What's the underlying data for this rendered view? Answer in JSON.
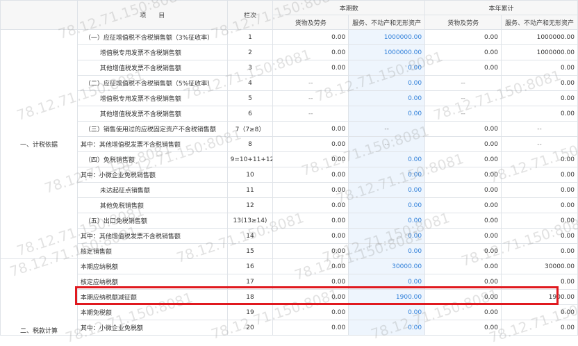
{
  "headers": {
    "item": "项　　目",
    "col": "栏次",
    "current": "本期数",
    "ytd": "本年累计",
    "goods": "货物及劳务",
    "services": "服务、不动产和无形资产"
  },
  "categories": {
    "basis": "一、计税依据",
    "calc": "二、税款计算"
  },
  "rows": [
    {
      "item": "（一）应征增值税不含税销售额（3%征收率）",
      "col": "1",
      "c1": "0.00",
      "c2": "1000000.00",
      "y1": "0.00",
      "y2": "1000000.00",
      "ind": 1
    },
    {
      "item": "增值税专用发票不含税销售额",
      "col": "2",
      "c1": "0.00",
      "c2": "1000000.00",
      "y1": "0.00",
      "y2": "1000000.00",
      "ind": 2
    },
    {
      "item": "其他增值税发票不含税销售额",
      "col": "3",
      "c1": "0.00",
      "c2": "0.00",
      "y1": "0.00",
      "y2": "0.00",
      "ind": 2
    },
    {
      "item": "（二）应征增值税不含税销售额（5%征收率）",
      "col": "4",
      "c1": "--",
      "c2": "0.00",
      "y1": "--",
      "y2": "0.00",
      "ind": 1
    },
    {
      "item": "增值税专用发票不含税销售额",
      "col": "5",
      "c1": "--",
      "c2": "0.00",
      "y1": "--",
      "y2": "0.00",
      "ind": 2
    },
    {
      "item": "其他增值税发票不含税销售额",
      "col": "6",
      "c1": "--",
      "c2": "0.00",
      "y1": "--",
      "y2": "0.00",
      "ind": 2
    },
    {
      "item": "（三）销售使用过的应税固定资产不含税销售额",
      "col": "7（7≥8）",
      "c1": "0.00",
      "c2": "--",
      "y1": "0.00",
      "y2": "--",
      "ind": 1
    },
    {
      "item": "其中：其他增值税发票不含税销售额",
      "col": "8",
      "c1": "0.00",
      "c2": "--",
      "y1": "0.00",
      "y2": "--",
      "ind": 3
    },
    {
      "item": "（四）免税销售额",
      "col": "9=10+11+12",
      "c1": "0.00",
      "c2": "0.00",
      "y1": "0.00",
      "y2": "0.00",
      "ind": 1
    },
    {
      "item": "其中：小微企业免税销售额",
      "col": "10",
      "c1": "0.00",
      "c2": "0.00",
      "y1": "0.00",
      "y2": "0.00",
      "ind": 3
    },
    {
      "item": "未达起征点销售额",
      "col": "11",
      "c1": "0.00",
      "c2": "0.00",
      "y1": "0.00",
      "y2": "0.00",
      "ind": 2
    },
    {
      "item": "其他免税销售额",
      "col": "12",
      "c1": "0.00",
      "c2": "0.00",
      "y1": "0.00",
      "y2": "0.00",
      "ind": 2
    },
    {
      "item": "（五）出口免税销售额",
      "col": "13(13≥14)",
      "c1": "0.00",
      "c2": "0.00",
      "y1": "0.00",
      "y2": "0.00",
      "ind": 1
    },
    {
      "item": "其中：其他增值税发票不含税销售额",
      "col": "14",
      "c1": "0.00",
      "c2": "0.00",
      "y1": "0.00",
      "y2": "0.00",
      "ind": 3
    },
    {
      "item": "核定销售额",
      "col": "15",
      "c1": "0.00",
      "c2": "0.00",
      "y1": "0.00",
      "y2": "0.00",
      "ind": 3
    },
    {
      "item": "本期应纳税额",
      "col": "16",
      "c1": "0.00",
      "c2": "30000.00",
      "y1": "0.00",
      "y2": "30000.00",
      "ind": 3
    },
    {
      "item": "核定应纳税额",
      "col": "17",
      "c1": "0.00",
      "c2": "0.00",
      "y1": "0.00",
      "y2": "0.00",
      "ind": 3
    },
    {
      "item": "本期应纳税额减征额",
      "col": "18",
      "c1": "0.00",
      "c2": "1900.00",
      "y1": "0.00",
      "y2": "1900.00",
      "ind": 3
    },
    {
      "item": "本期免税额",
      "col": "19",
      "c1": "0.00",
      "c2": "0.00",
      "y1": "0.00",
      "y2": "0.00",
      "ind": 3
    },
    {
      "item": "其中：小微企业免税额",
      "col": "20",
      "c1": "0.00",
      "c2": "0.00",
      "y1": "0.00",
      "y2": "0.00",
      "ind": 3
    }
  ],
  "watermark": "78.12.71.150:8081"
}
